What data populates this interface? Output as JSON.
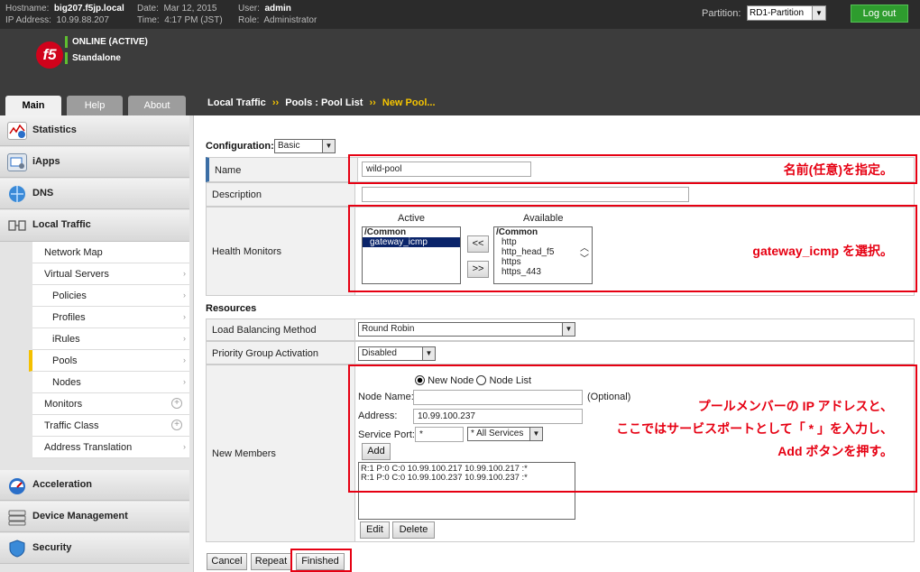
{
  "topbar": {
    "hostname_label": "Hostname:",
    "hostname": "big207.f5jp.local",
    "ip_label": "IP Address:",
    "ip": "10.99.88.207",
    "date_label": "Date:",
    "date": "Mar 12, 2015",
    "time_label": "Time:",
    "time": "4:17 PM (JST)",
    "user_label": "User:",
    "user": "admin",
    "role_label": "Role:",
    "role": "Administrator",
    "partition_label": "Partition:",
    "partition_value": "RD1-Partition",
    "logout_label": "Log out"
  },
  "banner": {
    "logo_text": "f5",
    "status": "ONLINE (ACTIVE)",
    "mode": "Standalone"
  },
  "tabs": [
    {
      "label": "Main"
    },
    {
      "label": "Help"
    },
    {
      "label": "About"
    }
  ],
  "breadcrumb": {
    "part1": "Local Traffic",
    "sep1": "››",
    "part2": "Pools : Pool List",
    "sep2": "››",
    "current": "New Pool..."
  },
  "sidebar": {
    "main_items": [
      {
        "label": "Statistics",
        "icon": "statistics-icon"
      },
      {
        "label": "iApps",
        "icon": "iapps-icon"
      },
      {
        "label": "DNS",
        "icon": "dns-icon"
      },
      {
        "label": "Local Traffic",
        "icon": "local-traffic-icon"
      },
      {
        "label": "Acceleration",
        "icon": "acceleration-icon"
      },
      {
        "label": "Device Management",
        "icon": "device-management-icon"
      },
      {
        "label": "Security",
        "icon": "security-icon"
      }
    ],
    "sub_items": [
      {
        "label": "Network Map"
      },
      {
        "label": "Virtual Servers"
      },
      {
        "label": "Policies"
      },
      {
        "label": "Profiles"
      },
      {
        "label": "iRules"
      },
      {
        "label": "Pools"
      },
      {
        "label": "Nodes"
      },
      {
        "label": "Monitors"
      },
      {
        "label": "Traffic Class"
      },
      {
        "label": "Address Translation"
      }
    ]
  },
  "form": {
    "configuration_label": "Configuration:",
    "configuration_value": "Basic",
    "name_label": "Name",
    "name_value": "wild-pool",
    "description_label": "Description",
    "description_value": "",
    "health_label": "Health Monitors",
    "active_header": "Active",
    "available_header": "Available",
    "active_group": "/Common",
    "active_items": [
      "gateway_icmp"
    ],
    "available_group": "/Common",
    "available_items": [
      "http",
      "http_head_f5",
      "https",
      "https_443"
    ],
    "move_left": "<<",
    "move_right": ">>",
    "resources_title": "Resources",
    "lb_label": "Load Balancing Method",
    "lb_value": "Round Robin",
    "pga_label": "Priority Group Activation",
    "pga_value": "Disabled",
    "members_label": "New Members",
    "radio_new_node": "New Node",
    "radio_node_list": "Node List",
    "node_name_label": "Node Name:",
    "node_name_value": "",
    "optional_text": "(Optional)",
    "address_label": "Address:",
    "address_value": "10.99.100.237",
    "service_port_label": "Service Port:",
    "service_port_value": "*",
    "service_select_value": "* All Services",
    "add_button": "Add",
    "members": [
      "R:1 P:0 C:0 10.99.100.217 10.99.100.217 :*",
      "R:1 P:0 C:0 10.99.100.237 10.99.100.237 :*"
    ],
    "edit_button": "Edit",
    "delete_button": "Delete",
    "cancel_button": "Cancel",
    "repeat_button": "Repeat",
    "finished_button": "Finished"
  },
  "annotations": {
    "name_note": "名前(任意)を指定。",
    "monitor_note": "gateway_icmp を選択。",
    "member_note_1": "プールメンバーの IP アドレスと、",
    "member_note_2": "ここではサービスポートとして「 * 」を入力し、",
    "member_note_3": "Add ボタンを押す。"
  },
  "colors": {
    "accent_red": "#e60012",
    "logout_green": "#2e9c2e",
    "current_yellow": "#f5c400",
    "status_green": "#5fbf2f"
  }
}
